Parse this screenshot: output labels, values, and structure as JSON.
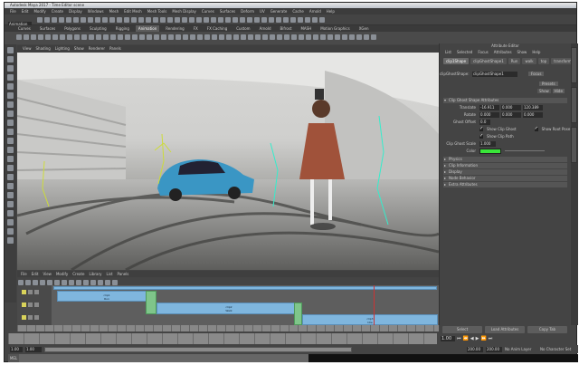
{
  "title": "Autodesk Maya 2017 - Time Editor scene",
  "menubar": [
    "File",
    "Edit",
    "Modify",
    "Create",
    "Display",
    "Windows",
    "Mesh",
    "Edit Mesh",
    "Mesh Tools",
    "Mesh Display",
    "Curves",
    "Surfaces",
    "Deform",
    "UV",
    "Generate",
    "Cache",
    "Arnold",
    "Help"
  ],
  "mode": "Animation",
  "shelf_tabs": [
    "Curves",
    "Surfaces",
    "Polygons",
    "Sculpting",
    "Rigging",
    "Animation",
    "Rendering",
    "FX",
    "FX Caching",
    "Custom",
    "Arnold",
    "Bifrost",
    "MASH",
    "Motion Graphics",
    "XGen"
  ],
  "shelf_active": "Animation",
  "panel_menu": [
    "View",
    "Shading",
    "Lighting",
    "Show",
    "Renderer",
    "Panels"
  ],
  "attribute_editor": {
    "title": "Attribute Editor",
    "menu": [
      "List",
      "Selected",
      "Focus",
      "Attributes",
      "Show",
      "Help"
    ],
    "tabs": [
      "clip1Shape",
      "clipGhostShape1",
      "Run",
      "walk",
      "top",
      "transform1"
    ],
    "active_tab": "clip1Shape",
    "node_label": "clipGhostShape:",
    "node_value": "clipGhostShape1",
    "focus_btn": "Focus",
    "presets_btn": "Presets",
    "show_btn": "Show",
    "hide_btn": "Hide",
    "open_section": "Clip Ghost Shape Attributes",
    "fields": [
      {
        "label": "Translate",
        "values": [
          "-16.911",
          "0.000",
          "120.389"
        ]
      },
      {
        "label": "Rotate",
        "values": [
          "0.000",
          "0.000",
          "0.000"
        ]
      }
    ],
    "ghost_offset_label": "Ghost Offset",
    "ghost_offset_value": "0.0",
    "checks": [
      "Show Clip Ghost",
      "Show Clip Path",
      "Show Root Pose"
    ],
    "scale_label": "Clip Ghost Scale",
    "scale_value": "1.000",
    "color_label": "Color",
    "ghost_color": "#39e639",
    "sections": [
      "Physics",
      "Clip Information",
      "Display",
      "Node Behavior",
      "Extra Attributes"
    ],
    "buttons": [
      "Select",
      "Load Attributes",
      "Copy Tab"
    ]
  },
  "time_editor": {
    "menu": [
      "File",
      "Edit",
      "View",
      "Modify",
      "Create",
      "Library",
      "List",
      "Panels"
    ],
    "tracks": [
      {
        "clip": "clip1",
        "sub": "Run",
        "range": "1-50"
      },
      {
        "clip": "clip2",
        "sub": "Walk",
        "range": "45-120"
      },
      {
        "clip": "clip3",
        "sub": "Idle",
        "range": "115-200"
      }
    ]
  },
  "playback": {
    "current_frame": "1.00",
    "start": "1.00",
    "inner_start": "1.00",
    "inner_end": "200.00",
    "end": "200.00",
    "anim_layer": "No Anim Layer",
    "char_set": "No Character Set"
  },
  "command_line": {
    "label": "MEL"
  }
}
